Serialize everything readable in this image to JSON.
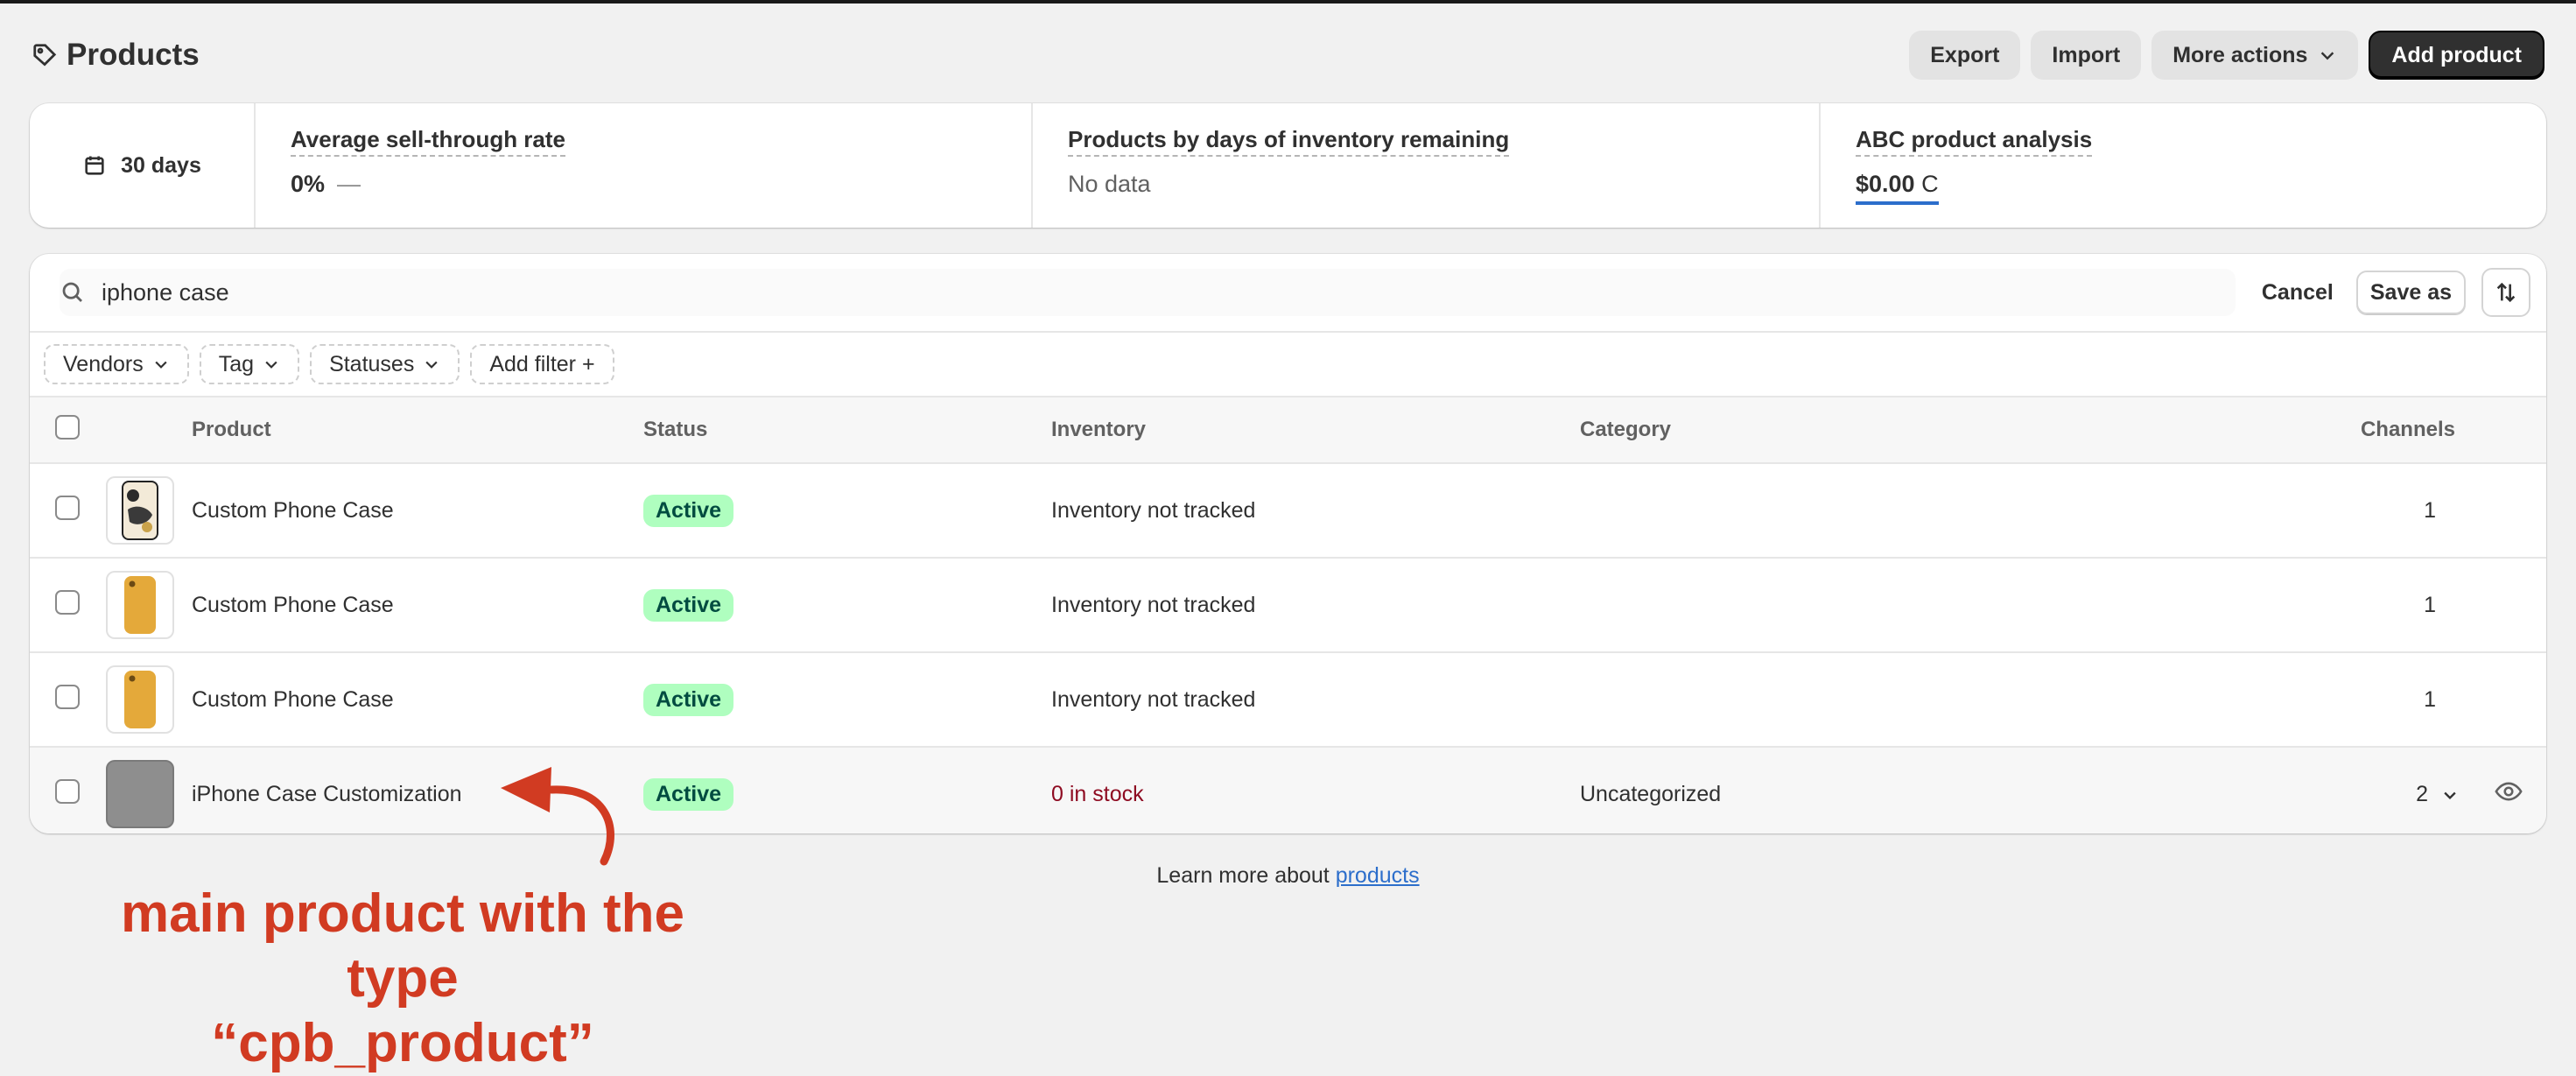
{
  "header": {
    "title": "Products",
    "actions": {
      "export": "Export",
      "import": "Import",
      "more": "More actions",
      "add": "Add product"
    }
  },
  "metrics": {
    "date_range": "30 days",
    "sell_through": {
      "label": "Average sell-through rate",
      "value": "0%",
      "trend": "—"
    },
    "days_inventory": {
      "label": "Products by days of inventory remaining",
      "value": "No data"
    },
    "abc": {
      "label": "ABC product analysis",
      "value": "$0.00",
      "extra": "C"
    }
  },
  "search": {
    "value": "iphone case",
    "cancel": "Cancel",
    "save_as": "Save as"
  },
  "filters": [
    "Vendors",
    "Tag",
    "Statuses",
    "Add filter +"
  ],
  "table": {
    "headers": {
      "product": "Product",
      "status": "Status",
      "inventory": "Inventory",
      "category": "Category",
      "channels": "Channels"
    },
    "rows": [
      {
        "name": "Custom Phone Case",
        "status": "Active",
        "inventory": "Inventory not tracked",
        "category": "",
        "channels": "1"
      },
      {
        "name": "Custom Phone Case",
        "status": "Active",
        "inventory": "Inventory not tracked",
        "category": "",
        "channels": "1"
      },
      {
        "name": "Custom Phone Case",
        "status": "Active",
        "inventory": "Inventory not tracked",
        "category": "",
        "channels": "1"
      },
      {
        "name": "iPhone Case Customization",
        "status": "Active",
        "inventory": "0 in stock",
        "category": "Uncategorized",
        "channels": "2"
      }
    ]
  },
  "footer": {
    "prefix": "Learn more about ",
    "link": "products"
  },
  "annotation": {
    "line1": "main product with the type",
    "line2": "“cpb_product”"
  },
  "colors": {
    "accent": "#2c6ecb",
    "badge_bg": "#affebf",
    "annotation": "#d13b22"
  }
}
